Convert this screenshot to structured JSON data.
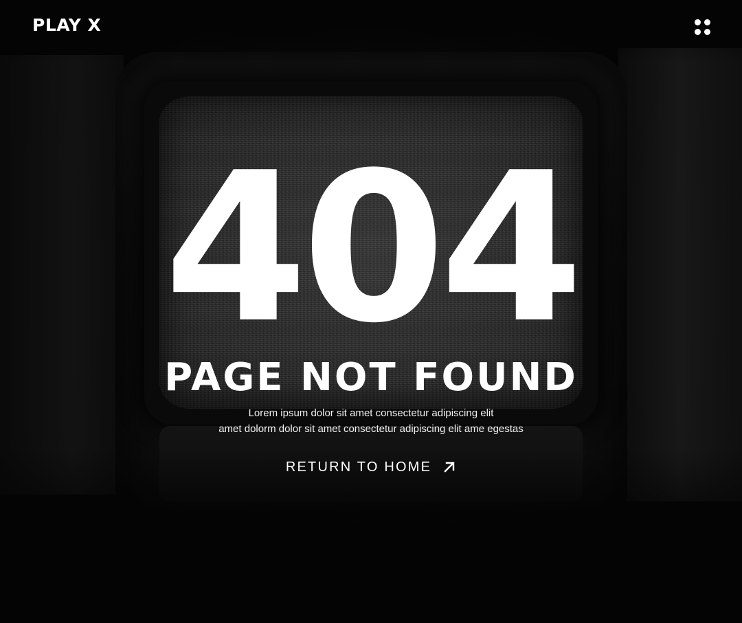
{
  "header": {
    "brand": "PLAY X",
    "menu_icon": "grid-dots-icon"
  },
  "main": {
    "code": "404",
    "title": "PAGE NOT FOUND",
    "description_lines": [
      "Lorem ipsum dolor sit amet consectetur adipiscing elit",
      "amet dolorm dolor sit amet consectetur adipiscing elit ame egestas"
    ],
    "home_link": {
      "label": "RETURN TO HOME",
      "icon": "arrow-up-right-icon"
    }
  },
  "colors": {
    "background": "#040404",
    "text": "#ffffff"
  }
}
